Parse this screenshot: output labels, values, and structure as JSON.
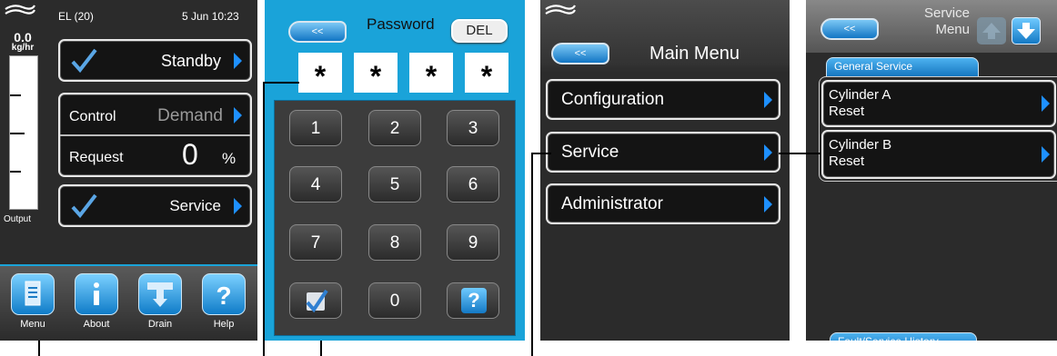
{
  "screen1": {
    "model": "EL (20)",
    "datetime": "5 Jun 10:23",
    "output_value": "0.0",
    "output_unit": "kg/hr",
    "output_label": "Output",
    "standby_label": "Standby",
    "control_label": "Control",
    "control_value": "Demand",
    "request_label": "Request",
    "request_value": "0",
    "request_unit": "%",
    "service_label": "Service",
    "bottom": [
      {
        "label": "Menu",
        "icon": "document-icon"
      },
      {
        "label": "About",
        "icon": "info-icon"
      },
      {
        "label": "Drain",
        "icon": "drain-icon"
      },
      {
        "label": "Help",
        "icon": "question-icon"
      }
    ]
  },
  "screen2": {
    "back_label": "<<",
    "title": "Password",
    "del_label": "DEL",
    "password_chars": [
      "*",
      "*",
      "*",
      "*"
    ],
    "keys": [
      "1",
      "2",
      "3",
      "4",
      "5",
      "6",
      "7",
      "8",
      "9",
      "0"
    ],
    "help_key": "?"
  },
  "screen3": {
    "back_label": "<<",
    "title": "Main Menu",
    "items": [
      "Configuration",
      "Service",
      "Administrator"
    ]
  },
  "screen4": {
    "back_label": "<<",
    "title_line1": "Service",
    "title_line2": "Menu",
    "tab_general": "General Service",
    "items": [
      {
        "line1": "Cylinder A",
        "line2": "Reset"
      },
      {
        "line1": "Cylinder B",
        "line2": "Reset"
      }
    ],
    "tab_history": "Fault/Service History"
  },
  "colors": {
    "accent_blue": "#1aa3d9",
    "screen_bg": "#2b2b2b",
    "chevron_blue": "#1e90ff"
  }
}
